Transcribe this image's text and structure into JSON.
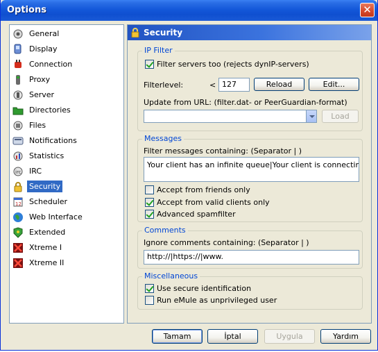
{
  "window": {
    "title": "Options",
    "close_glyph": "✕"
  },
  "sidebar": {
    "items": [
      {
        "label": "General",
        "icon": "general-icon"
      },
      {
        "label": "Display",
        "icon": "display-icon"
      },
      {
        "label": "Connection",
        "icon": "connection-icon"
      },
      {
        "label": "Proxy",
        "icon": "proxy-icon"
      },
      {
        "label": "Server",
        "icon": "server-icon"
      },
      {
        "label": "Directories",
        "icon": "directories-icon"
      },
      {
        "label": "Files",
        "icon": "files-icon"
      },
      {
        "label": "Notifications",
        "icon": "notifications-icon"
      },
      {
        "label": "Statistics",
        "icon": "statistics-icon"
      },
      {
        "label": "IRC",
        "icon": "irc-icon"
      },
      {
        "label": "Security",
        "icon": "lock-icon",
        "selected": true
      },
      {
        "label": "Scheduler",
        "icon": "scheduler-icon"
      },
      {
        "label": "Web Interface",
        "icon": "globe-icon"
      },
      {
        "label": "Extended",
        "icon": "extended-icon"
      },
      {
        "label": "Xtreme I",
        "icon": "xtreme-icon"
      },
      {
        "label": "Xtreme II",
        "icon": "xtreme-icon"
      }
    ]
  },
  "panel": {
    "header": "Security",
    "ip_filter": {
      "legend": "IP Filter",
      "filter_servers": {
        "label": "Filter servers too (rejects dynIP-servers)",
        "checked": true
      },
      "filterlevel_label": "Filterlevel:",
      "lt_symbol": "<",
      "filterlevel_value": "127",
      "reload_label": "Reload",
      "edit_label": "Edit...",
      "update_label": "Update from URL: (filter.dat- or PeerGuardian-format)",
      "url_value": "",
      "load_label": "Load"
    },
    "messages": {
      "legend": "Messages",
      "filter_label": "Filter messages containing: (Separator | )",
      "filter_value": "Your client has an infinite queue|Your client is connecting too f",
      "accept_friends": {
        "label": "Accept from friends only",
        "checked": false
      },
      "accept_valid": {
        "label": "Accept from valid clients only",
        "checked": true
      },
      "advanced_spam": {
        "label": "Advanced spamfilter",
        "checked": true
      }
    },
    "comments": {
      "legend": "Comments",
      "ignore_label": "Ignore comments containing: (Separator | )",
      "ignore_value": "http://|https://|www."
    },
    "misc": {
      "legend": "Miscellaneous",
      "secure_id": {
        "label": "Use secure identification",
        "checked": true
      },
      "unprivileged": {
        "label": "Run eMule as unprivileged user",
        "checked": false
      }
    }
  },
  "buttons": {
    "ok": "Tamam",
    "cancel": "İptal",
    "apply": "Uygula",
    "help": "Yardım"
  }
}
